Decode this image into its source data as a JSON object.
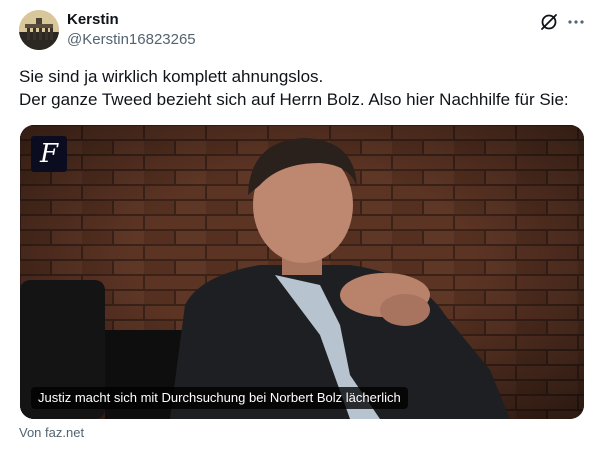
{
  "author": {
    "name": "Kerstin",
    "handle": "@Kerstin16823265"
  },
  "tweet": {
    "lines": [
      "Sie sind ja wirklich komplett ahnungslos.",
      "Der ganze Tweed bezieht sich auf Herrn Bolz. Also hier Nachhilfe für Sie:"
    ]
  },
  "card": {
    "logo_glyph": "F",
    "headline": "Justiz macht sich mit Durchsuchung bei Norbert Bolz lächerlich",
    "source": "Von faz.net"
  },
  "icons": {
    "grok": "grok-icon",
    "more": "more-icon"
  },
  "colors": {
    "text": "#0f1419",
    "secondary": "#536471",
    "badge_bg": "#0c0c20"
  }
}
